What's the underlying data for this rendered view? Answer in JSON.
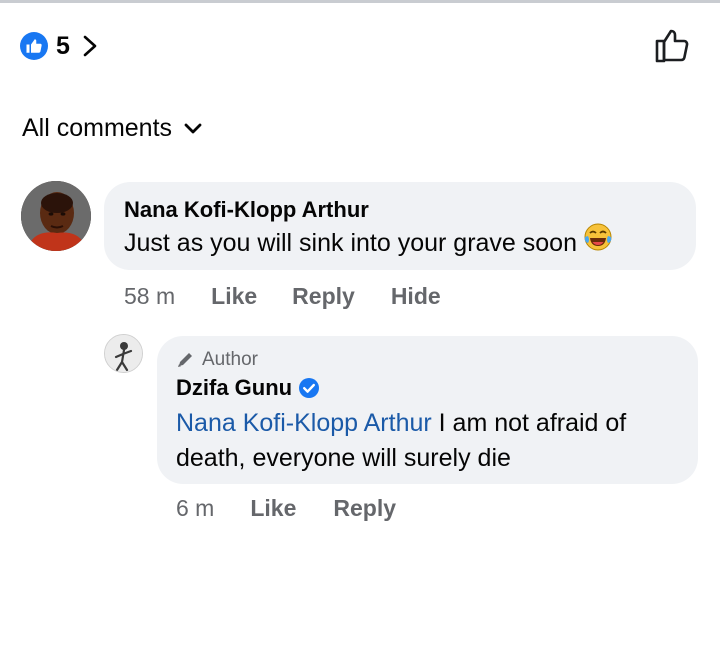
{
  "reactions": {
    "count": "5",
    "like_icon": "thumbs-up-filled-icon",
    "accent": "#1877f2"
  },
  "sort": {
    "label": "All comments"
  },
  "comments": [
    {
      "author": "Nana Kofi-Klopp Arthur",
      "text": "Just as you will sink into your grave soon",
      "emoji": "tears-of-joy-emoji",
      "time": "58 m",
      "actions": [
        "Like",
        "Reply",
        "Hide"
      ]
    },
    {
      "badge": "Author",
      "author": "Dzifa Gunu",
      "verified": true,
      "mention": "Nana Kofi-Klopp Arthur",
      "text": " I am not afraid of death, everyone will surely die",
      "time": "6 m",
      "actions": [
        "Like",
        "Reply"
      ]
    }
  ],
  "colors": {
    "bubble": "#f0f2f5",
    "meta_text": "#65676b",
    "mention": "#1b5aa8"
  }
}
